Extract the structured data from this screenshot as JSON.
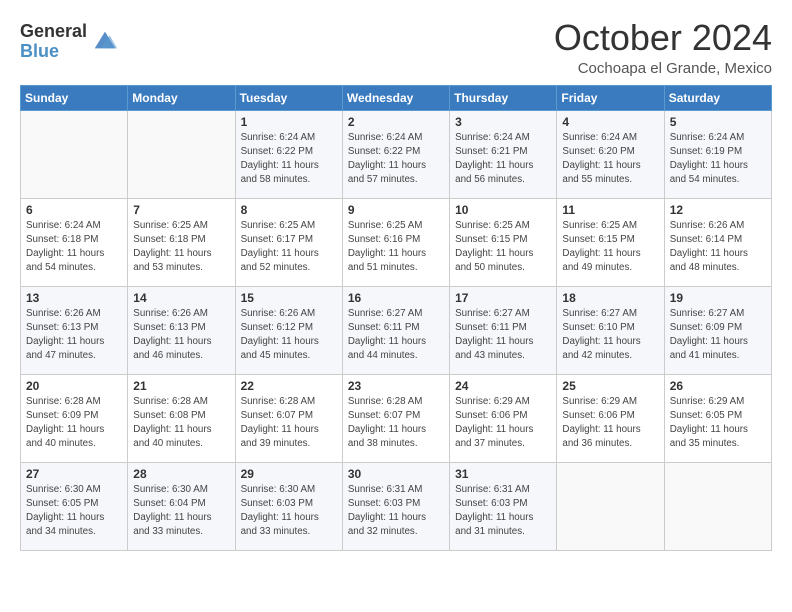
{
  "header": {
    "logo": {
      "line1": "General",
      "line2": "Blue"
    },
    "title": "October 2024",
    "location": "Cochoapa el Grande, Mexico"
  },
  "weekdays": [
    "Sunday",
    "Monday",
    "Tuesday",
    "Wednesday",
    "Thursday",
    "Friday",
    "Saturday"
  ],
  "weeks": [
    [
      {
        "day": "",
        "sunrise": "",
        "sunset": "",
        "daylight": ""
      },
      {
        "day": "",
        "sunrise": "",
        "sunset": "",
        "daylight": ""
      },
      {
        "day": "1",
        "sunrise": "Sunrise: 6:24 AM",
        "sunset": "Sunset: 6:22 PM",
        "daylight": "Daylight: 11 hours and 58 minutes."
      },
      {
        "day": "2",
        "sunrise": "Sunrise: 6:24 AM",
        "sunset": "Sunset: 6:22 PM",
        "daylight": "Daylight: 11 hours and 57 minutes."
      },
      {
        "day": "3",
        "sunrise": "Sunrise: 6:24 AM",
        "sunset": "Sunset: 6:21 PM",
        "daylight": "Daylight: 11 hours and 56 minutes."
      },
      {
        "day": "4",
        "sunrise": "Sunrise: 6:24 AM",
        "sunset": "Sunset: 6:20 PM",
        "daylight": "Daylight: 11 hours and 55 minutes."
      },
      {
        "day": "5",
        "sunrise": "Sunrise: 6:24 AM",
        "sunset": "Sunset: 6:19 PM",
        "daylight": "Daylight: 11 hours and 54 minutes."
      }
    ],
    [
      {
        "day": "6",
        "sunrise": "Sunrise: 6:24 AM",
        "sunset": "Sunset: 6:18 PM",
        "daylight": "Daylight: 11 hours and 54 minutes."
      },
      {
        "day": "7",
        "sunrise": "Sunrise: 6:25 AM",
        "sunset": "Sunset: 6:18 PM",
        "daylight": "Daylight: 11 hours and 53 minutes."
      },
      {
        "day": "8",
        "sunrise": "Sunrise: 6:25 AM",
        "sunset": "Sunset: 6:17 PM",
        "daylight": "Daylight: 11 hours and 52 minutes."
      },
      {
        "day": "9",
        "sunrise": "Sunrise: 6:25 AM",
        "sunset": "Sunset: 6:16 PM",
        "daylight": "Daylight: 11 hours and 51 minutes."
      },
      {
        "day": "10",
        "sunrise": "Sunrise: 6:25 AM",
        "sunset": "Sunset: 6:15 PM",
        "daylight": "Daylight: 11 hours and 50 minutes."
      },
      {
        "day": "11",
        "sunrise": "Sunrise: 6:25 AM",
        "sunset": "Sunset: 6:15 PM",
        "daylight": "Daylight: 11 hours and 49 minutes."
      },
      {
        "day": "12",
        "sunrise": "Sunrise: 6:26 AM",
        "sunset": "Sunset: 6:14 PM",
        "daylight": "Daylight: 11 hours and 48 minutes."
      }
    ],
    [
      {
        "day": "13",
        "sunrise": "Sunrise: 6:26 AM",
        "sunset": "Sunset: 6:13 PM",
        "daylight": "Daylight: 11 hours and 47 minutes."
      },
      {
        "day": "14",
        "sunrise": "Sunrise: 6:26 AM",
        "sunset": "Sunset: 6:13 PM",
        "daylight": "Daylight: 11 hours and 46 minutes."
      },
      {
        "day": "15",
        "sunrise": "Sunrise: 6:26 AM",
        "sunset": "Sunset: 6:12 PM",
        "daylight": "Daylight: 11 hours and 45 minutes."
      },
      {
        "day": "16",
        "sunrise": "Sunrise: 6:27 AM",
        "sunset": "Sunset: 6:11 PM",
        "daylight": "Daylight: 11 hours and 44 minutes."
      },
      {
        "day": "17",
        "sunrise": "Sunrise: 6:27 AM",
        "sunset": "Sunset: 6:11 PM",
        "daylight": "Daylight: 11 hours and 43 minutes."
      },
      {
        "day": "18",
        "sunrise": "Sunrise: 6:27 AM",
        "sunset": "Sunset: 6:10 PM",
        "daylight": "Daylight: 11 hours and 42 minutes."
      },
      {
        "day": "19",
        "sunrise": "Sunrise: 6:27 AM",
        "sunset": "Sunset: 6:09 PM",
        "daylight": "Daylight: 11 hours and 41 minutes."
      }
    ],
    [
      {
        "day": "20",
        "sunrise": "Sunrise: 6:28 AM",
        "sunset": "Sunset: 6:09 PM",
        "daylight": "Daylight: 11 hours and 40 minutes."
      },
      {
        "day": "21",
        "sunrise": "Sunrise: 6:28 AM",
        "sunset": "Sunset: 6:08 PM",
        "daylight": "Daylight: 11 hours and 40 minutes."
      },
      {
        "day": "22",
        "sunrise": "Sunrise: 6:28 AM",
        "sunset": "Sunset: 6:07 PM",
        "daylight": "Daylight: 11 hours and 39 minutes."
      },
      {
        "day": "23",
        "sunrise": "Sunrise: 6:28 AM",
        "sunset": "Sunset: 6:07 PM",
        "daylight": "Daylight: 11 hours and 38 minutes."
      },
      {
        "day": "24",
        "sunrise": "Sunrise: 6:29 AM",
        "sunset": "Sunset: 6:06 PM",
        "daylight": "Daylight: 11 hours and 37 minutes."
      },
      {
        "day": "25",
        "sunrise": "Sunrise: 6:29 AM",
        "sunset": "Sunset: 6:06 PM",
        "daylight": "Daylight: 11 hours and 36 minutes."
      },
      {
        "day": "26",
        "sunrise": "Sunrise: 6:29 AM",
        "sunset": "Sunset: 6:05 PM",
        "daylight": "Daylight: 11 hours and 35 minutes."
      }
    ],
    [
      {
        "day": "27",
        "sunrise": "Sunrise: 6:30 AM",
        "sunset": "Sunset: 6:05 PM",
        "daylight": "Daylight: 11 hours and 34 minutes."
      },
      {
        "day": "28",
        "sunrise": "Sunrise: 6:30 AM",
        "sunset": "Sunset: 6:04 PM",
        "daylight": "Daylight: 11 hours and 33 minutes."
      },
      {
        "day": "29",
        "sunrise": "Sunrise: 6:30 AM",
        "sunset": "Sunset: 6:03 PM",
        "daylight": "Daylight: 11 hours and 33 minutes."
      },
      {
        "day": "30",
        "sunrise": "Sunrise: 6:31 AM",
        "sunset": "Sunset: 6:03 PM",
        "daylight": "Daylight: 11 hours and 32 minutes."
      },
      {
        "day": "31",
        "sunrise": "Sunrise: 6:31 AM",
        "sunset": "Sunset: 6:03 PM",
        "daylight": "Daylight: 11 hours and 31 minutes."
      },
      {
        "day": "",
        "sunrise": "",
        "sunset": "",
        "daylight": ""
      },
      {
        "day": "",
        "sunrise": "",
        "sunset": "",
        "daylight": ""
      }
    ]
  ]
}
